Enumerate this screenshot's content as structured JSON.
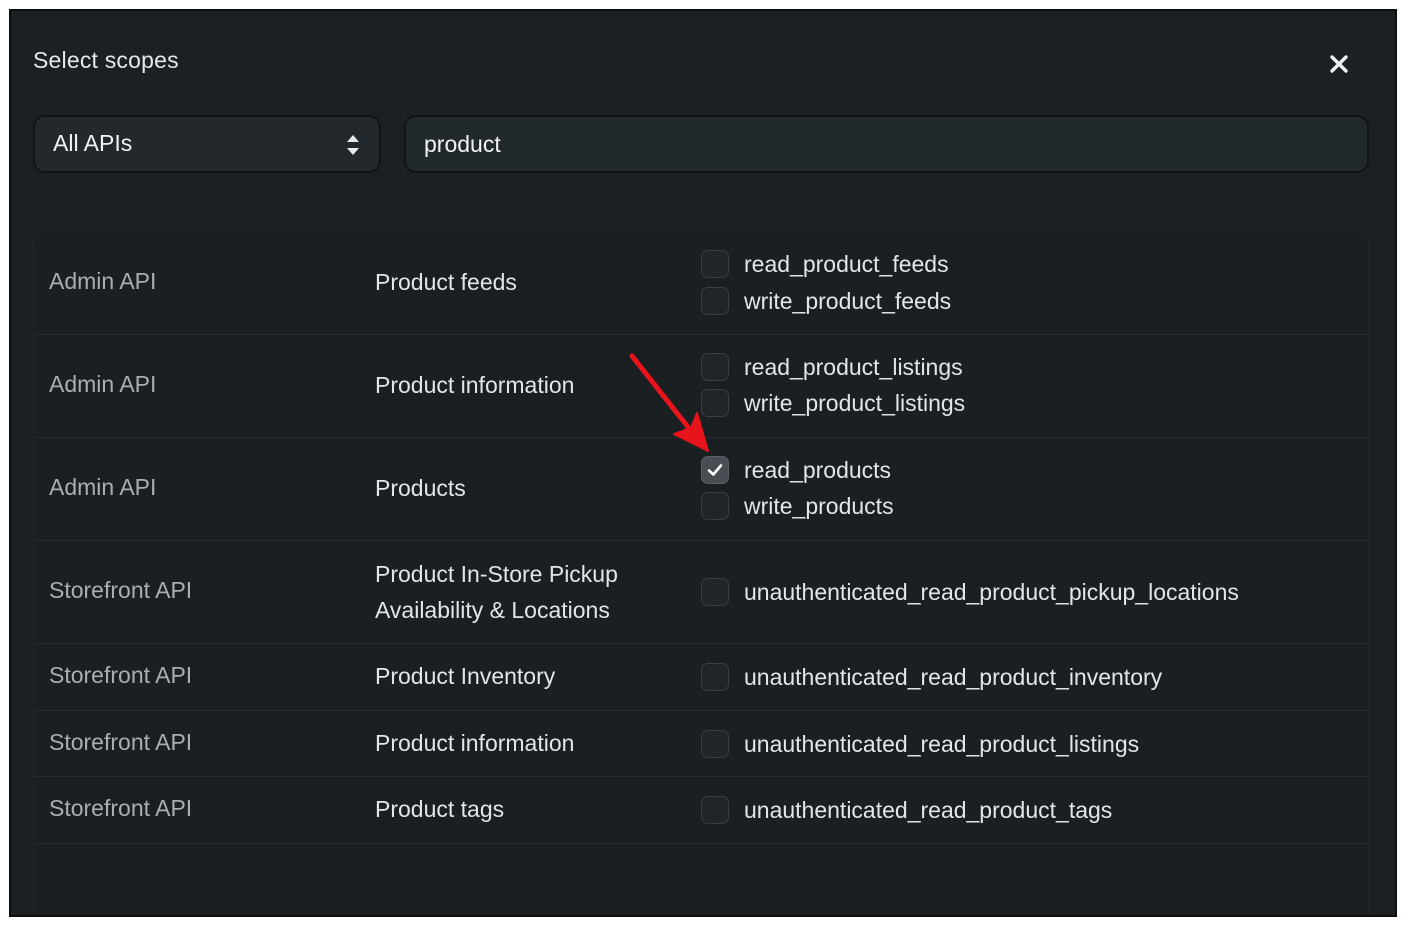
{
  "dialog": {
    "title": "Select scopes"
  },
  "filter": {
    "select_value": "All APIs",
    "search_value": "product"
  },
  "rows": [
    {
      "api": "Admin API",
      "name": "Product feeds",
      "scopes": [
        {
          "label": "read_product_feeds",
          "checked": false
        },
        {
          "label": "write_product_feeds",
          "checked": false
        }
      ]
    },
    {
      "api": "Admin API",
      "name": "Product information",
      "scopes": [
        {
          "label": "read_product_listings",
          "checked": false
        },
        {
          "label": "write_product_listings",
          "checked": false
        }
      ]
    },
    {
      "api": "Admin API",
      "name": "Products",
      "scopes": [
        {
          "label": "read_products",
          "checked": true
        },
        {
          "label": "write_products",
          "checked": false
        }
      ]
    },
    {
      "api": "Storefront API",
      "name_lines": [
        "Product In-Store Pickup",
        "Availability & Locations"
      ],
      "scopes": [
        {
          "label": "unauthenticated_read_product_pickup_locations",
          "checked": false
        }
      ]
    },
    {
      "api": "Storefront API",
      "name": "Product Inventory",
      "scopes": [
        {
          "label": "unauthenticated_read_product_inventory",
          "checked": false
        }
      ]
    },
    {
      "api": "Storefront API",
      "name": "Product information",
      "scopes": [
        {
          "label": "unauthenticated_read_product_listings",
          "checked": false
        }
      ]
    },
    {
      "api": "Storefront API",
      "name": "Product tags",
      "scopes": [
        {
          "label": "unauthenticated_read_product_tags",
          "checked": false
        }
      ]
    }
  ],
  "colors": {
    "background": "#1b2023",
    "annotation_arrow": "#e8141c"
  }
}
